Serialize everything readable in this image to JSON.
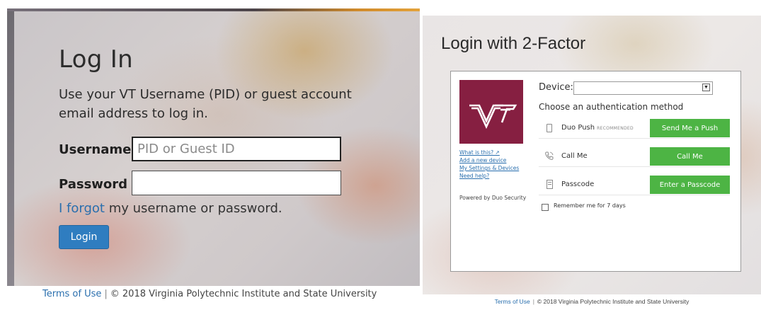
{
  "login": {
    "title": "Log In",
    "instructions": "Use your VT Username (PID) or guest account email address to log in.",
    "username_label": "Username",
    "username_placeholder": "PID or Guest ID",
    "username_value": "",
    "password_label": "Password",
    "password_value": "",
    "forgot_link": "I forgot",
    "forgot_rest": " my username or password.",
    "login_button": "Login"
  },
  "left_footer": {
    "terms": "Terms of Use",
    "separator": "|",
    "copyright": "© 2018 Virginia Polytechnic Institute and State University"
  },
  "twofactor": {
    "title": "Login with 2-Factor",
    "logo": "VT",
    "links": [
      "What is this? ↗",
      "Add a new device",
      "My Settings & Devices",
      "Need help?"
    ],
    "powered_by": "Powered by Duo Security",
    "device_label": "Device:",
    "device_selected": "",
    "auth_heading": "Choose an authentication method",
    "methods": [
      {
        "name": "Duo Push",
        "tag": "RECOMMENDED",
        "button": "Send Me a Push",
        "icon": "phone-icon"
      },
      {
        "name": "Call Me",
        "tag": "",
        "button": "Call Me",
        "icon": "phone-call-icon"
      },
      {
        "name": "Passcode",
        "tag": "",
        "button": "Enter a Passcode",
        "icon": "passcode-icon"
      }
    ],
    "remember_label": "Remember me for 7 days",
    "remember_checked": false,
    "accent_color": "#4db444",
    "logo_color": "#861f41"
  },
  "right_footer": {
    "terms": "Terms of Use",
    "separator": "|",
    "copyright": "© 2018 Virginia Polytechnic Institute and State University"
  }
}
